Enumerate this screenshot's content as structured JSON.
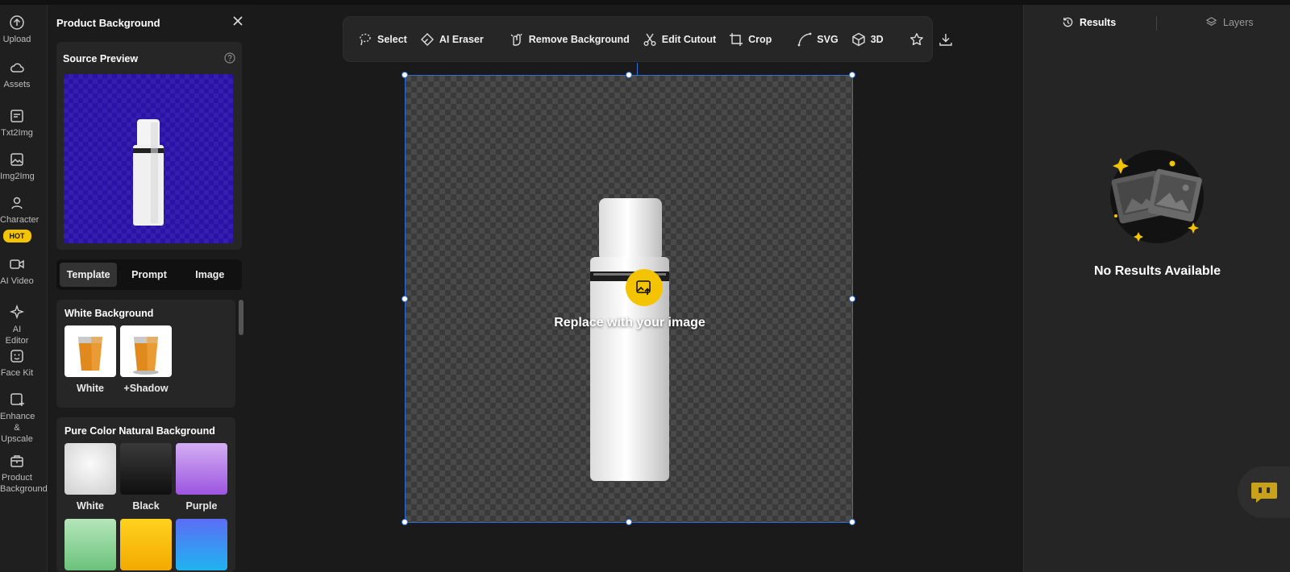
{
  "rail": {
    "items": [
      {
        "label": "Upload",
        "icon": "upload-icon"
      },
      {
        "label": "Assets",
        "icon": "cloud-icon"
      },
      {
        "label": "Txt2Img",
        "icon": "text-image-icon"
      },
      {
        "label": "Img2Img",
        "icon": "image-icon"
      },
      {
        "label": "Character",
        "icon": "character-icon",
        "badge": "HOT"
      },
      {
        "label": "AI Video",
        "icon": "video-icon"
      },
      {
        "label": "AI Editor",
        "icon": "sparkle-icon"
      },
      {
        "label": "Face Kit",
        "icon": "face-icon"
      },
      {
        "label": "Enhance & Upscale",
        "icon": "enhance-icon"
      },
      {
        "label": "Product Background",
        "icon": "product-icon"
      }
    ]
  },
  "sidebar": {
    "title": "Product Background",
    "source_preview_title": "Source Preview",
    "tabs": [
      "Template",
      "Prompt",
      "Image"
    ],
    "active_tab": "Template",
    "white_section": {
      "title": "White Background",
      "items": [
        {
          "label": "White"
        },
        {
          "label": "+Shadow"
        }
      ]
    },
    "pure_section": {
      "title": "Pure Color Natural Background",
      "items": [
        {
          "label": "White",
          "color": "#e6e6e6"
        },
        {
          "label": "Black",
          "color": "#1a1a1a"
        },
        {
          "label": "Purple",
          "color": "#b27ae6"
        },
        {
          "label": "",
          "color": "#8fd49a"
        },
        {
          "label": "",
          "color": "#f5b800"
        },
        {
          "label": "",
          "color": "#3a7ff0"
        }
      ]
    }
  },
  "toolbar": {
    "items": [
      {
        "label": "Select",
        "icon": "lasso-icon"
      },
      {
        "label": "AI Eraser",
        "icon": "eraser-icon"
      },
      {
        "label": "Remove Background",
        "icon": "remove-bg-icon"
      },
      {
        "label": "Edit Cutout",
        "icon": "scissors-icon"
      },
      {
        "label": "Crop",
        "icon": "crop-icon"
      },
      {
        "label": "SVG",
        "icon": "pen-curve-icon"
      },
      {
        "label": "3D",
        "icon": "cube-icon"
      }
    ],
    "icon_buttons": [
      "star-icon",
      "download-icon"
    ]
  },
  "canvas": {
    "replace_text": "Replace with your image"
  },
  "right_panel": {
    "tabs": [
      {
        "label": "Results",
        "icon": "history-icon",
        "active": true
      },
      {
        "label": "Layers",
        "icon": "layers-icon",
        "active": false
      }
    ],
    "empty_text": "No Results Available"
  },
  "colors": {
    "accent": "#f5c400",
    "selection": "#2f6fd8",
    "preview_bg": "#2a12a8"
  }
}
